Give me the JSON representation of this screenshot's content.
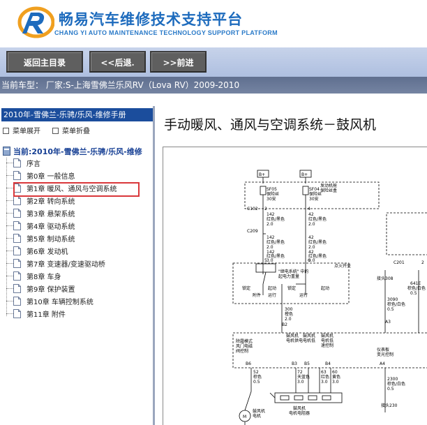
{
  "header": {
    "title": "畅易汽车维修技术支持平台",
    "subtitle": "CHANG YI AUTO MAINTENANCE TECHNOLOGY SUPPORT PLATFORM",
    "logo_icon": "r-logo-icon"
  },
  "nav": {
    "home_label": "返回主目录",
    "back_label": "<<后退.",
    "forward_label": ">>前进"
  },
  "vehicle_line": "当前车型：  厂家:S-上海雪佛兰乐风RV（Lova RV）2009-2010",
  "sidebar": {
    "manual_title": "2010年-雪佛兰-乐骋/乐风-维修手册",
    "expand_label": "菜单展开",
    "collapse_label": "菜单折叠",
    "current_label": "当前:2010年-雪佛兰-乐骋/乐风-维修",
    "items": [
      {
        "label": "序言"
      },
      {
        "label": "第0章  一般信息"
      },
      {
        "label": "第1章  暖风、通风与空调系统"
      },
      {
        "label": "第2章  转向系统"
      },
      {
        "label": "第3章  悬架系统"
      },
      {
        "label": "第4章  驱动系统"
      },
      {
        "label": "第5章  制动系统"
      },
      {
        "label": "第6章  发动机"
      },
      {
        "label": "第7章  变速器/变速驱动桥"
      },
      {
        "label": "第8章  车身"
      },
      {
        "label": "第9章  保护装置"
      },
      {
        "label": "第10章  车辆控制系统"
      },
      {
        "label": "第11章  附件"
      }
    ],
    "selected_index": 2,
    "highlight_color": "#d9373a"
  },
  "content": {
    "heading": "手动暖风、通风与空调系统－鼓风机",
    "diagram": {
      "batt1": "B+",
      "batt2": "B+",
      "fuse_left_code": "SF05",
      "fuse_left_name": "保险丝",
      "fuse_left_amp": "30安",
      "fuse_right_code": "SF04",
      "fuse_right_name": "保险丝",
      "fuse_right_amp": "30安",
      "engine_fusebox": "发动机舱",
      "engine_fusebox2": "保险丝盒",
      "c102": "C102",
      "c209": "C209",
      "w1_num": "142",
      "w1_color": "红色/黑色",
      "w1_size": "2.0",
      "w2_num": "142",
      "w2_color": "红色/黑色",
      "w2_size": "2.0",
      "w3_num": "142",
      "w3_color": "红色/黑色",
      "w3_size": "3.0",
      "w4_num": "42",
      "w4_color": "红色/黑色",
      "w4_size": "2.0",
      "w5_num": "42",
      "w5_color": "红色/黑色",
      "w5_size": "2.0",
      "w6_num": "42",
      "w6_color": "红色/黑色",
      "w6_size": "3.0",
      "pin2": "2",
      "pin4": "4",
      "pin5": "5",
      "pin6": "6",
      "relay_label1": "\"继电系统\" 中的",
      "relay_label2": "起电力重量",
      "ignition_switch": "点火开关",
      "sw_lock": "锁定",
      "sw_acc": "附件",
      "sw_run": "运行",
      "sw_start": "起动",
      "sw_lock2": "锁定",
      "sw_run2": "运行",
      "sw_start2": "起动",
      "w300_num": "300",
      "w300_color": "橙色",
      "w300_size": "2.0",
      "b2": "B2",
      "ground308": "接头308",
      "w3090": "3090",
      "w3090_color": "棕色/白色",
      "w3090_size": "0.5",
      "w641": "641E",
      "w641_color": "棕色/白色",
      "w641_size": "0.5",
      "a3": "A3",
      "c201": "C201",
      "c2": "2",
      "mode_ctrl1": "除霜模式",
      "mode_ctrl2": "风门电磁",
      "mode_ctrl3": "阀控制",
      "blower_ctrl1": "鼓风机",
      "blower_ctrl2": "电机供电",
      "blower_ctrl3": "鼓风机",
      "blower_ctrl4": "电机低",
      "blower_ctrl5": "鼓风机",
      "blower_ctrl6": "电机低",
      "blower_ctrl7": "速控制",
      "panel1": "仪表板",
      "panel2": "变光控制",
      "b6": "B6",
      "b3": "B3",
      "b5": "B5",
      "b4": "B4",
      "a4": "A4",
      "w52": "52",
      "w52_color": "棕色",
      "w52_size": "0.5",
      "w72": "72",
      "w72_color": "天蓝色",
      "w72_size": "3.0",
      "w63": "63",
      "w63_color": "红色",
      "w63_size": "3.0",
      "w60": "60",
      "w60_color": "黄色",
      "w60_size": "3.0",
      "w2300": "2300",
      "w2300_color": "棕色/白色",
      "w2300_size": "0.5",
      "motor1": "鼓风机",
      "motor2": "电机",
      "resistor1": "鼓风机",
      "resistor2": "电机电阻器",
      "ground230": "接头230",
      "m_label": "M"
    }
  }
}
